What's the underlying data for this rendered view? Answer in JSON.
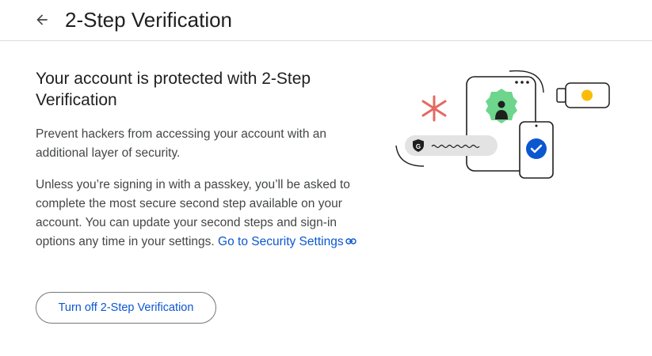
{
  "header": {
    "back_icon": "arrow-back-icon",
    "title": "2-Step Verification"
  },
  "main": {
    "heading": "Your account is protected with 2-Step Verification",
    "paragraph1": "Prevent hackers from accessing your account with an additional layer of security.",
    "paragraph2": "Unless you’re signing in with a passkey, you’ll be asked to complete the most secure second step available on your account. You can update your second steps and sign-in options any time in your settings.",
    "security_link": "Go to Security Settings",
    "link_icon": "link-icon",
    "turn_off_button": "Turn off 2-Step Verification"
  },
  "illustration": {
    "google_badge_letter": "G",
    "colors": {
      "accent_blue": "#0b57d0",
      "green": "#6dd58c",
      "red": "#e46962",
      "yellow": "#fbbc04",
      "pill_gray": "#e3e3e3"
    }
  }
}
